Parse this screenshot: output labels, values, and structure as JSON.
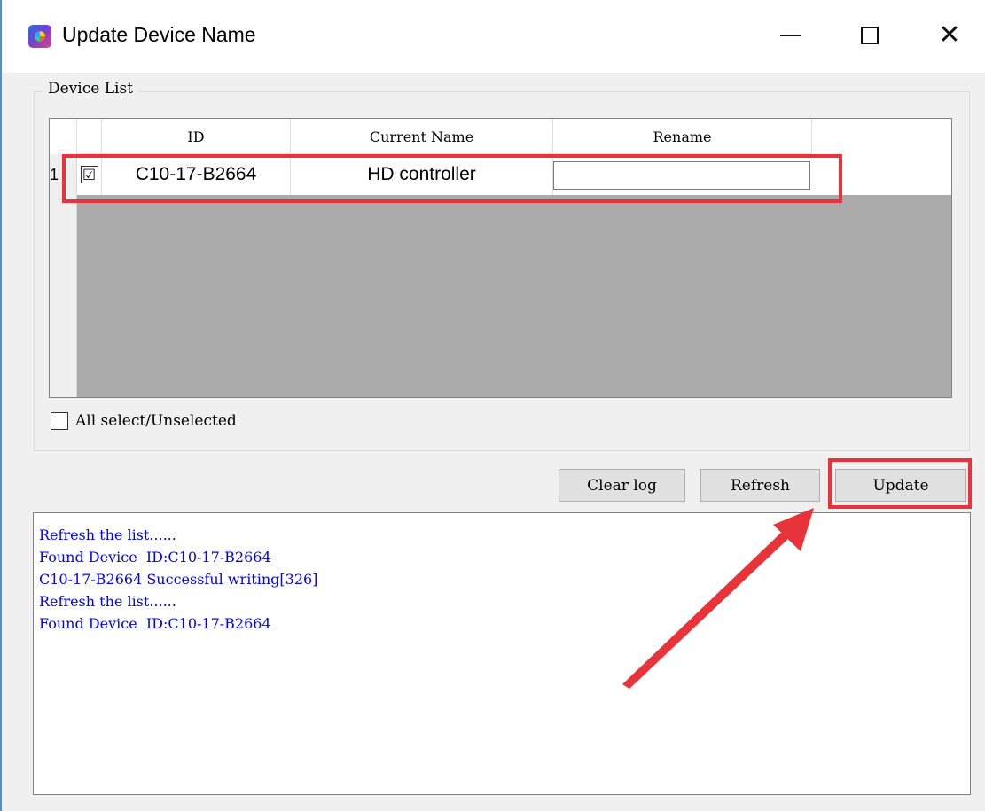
{
  "window": {
    "title": "Update Device Name",
    "icon": "app-icon",
    "controls": [
      "minimize-icon",
      "maximize-icon",
      "close-icon"
    ]
  },
  "device_list": {
    "group_title": "Device List",
    "columns": [
      "ID",
      "Current Name",
      "Rename"
    ],
    "rows": [
      {
        "row_number": "1",
        "checked": true,
        "id": "C10-17-B2664",
        "current_name": "HD controller",
        "rename": ""
      }
    ],
    "check_mark": "☑"
  },
  "all_select": {
    "label": "All select/Unselected",
    "checked": false
  },
  "buttons": {
    "clear_log": "Clear log",
    "refresh": "Refresh",
    "update": "Update"
  },
  "log": [
    "Refresh the list......",
    "Found Device  ID:C10-17-B2664",
    "C10-17-B2664 Successful writing[326]",
    "Refresh the list......",
    "Found Device  ID:C10-17-B2664"
  ],
  "colors": {
    "highlight": "#e8333a",
    "log_text": "#0000ff",
    "arrow": "#e8333a"
  }
}
